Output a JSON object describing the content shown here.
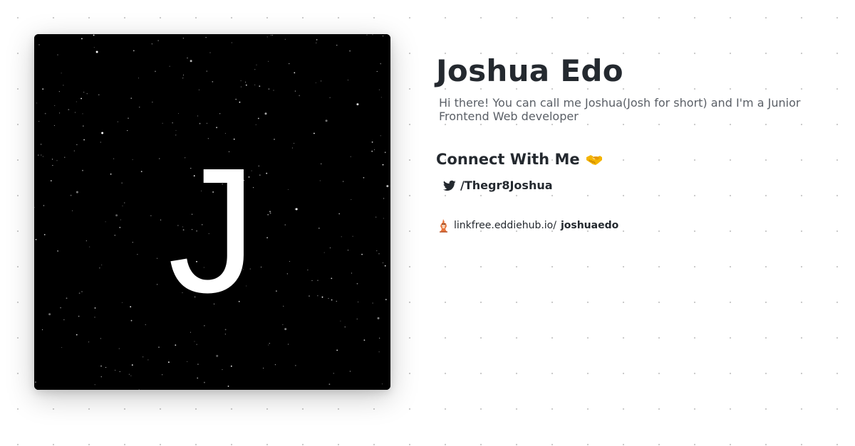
{
  "profile": {
    "avatar_letter": "J",
    "name": "Joshua Edo",
    "bio": "Hi there! You can call me Joshua(Josh for short) and I'm a Junior Frontend Web developer"
  },
  "connect": {
    "heading": "Connect With Me",
    "heading_icon": "handshake-icon",
    "links": [
      {
        "icon": "twitter-icon",
        "label": "/Thegr8Joshua"
      }
    ]
  },
  "footer": {
    "icon": "linkfree-logo-icon",
    "domain": "linkfree.eddiehub.io/",
    "username": "joshuaedo"
  },
  "colors": {
    "avatar_background": "#000000",
    "avatar_letter": "#ffffff",
    "heading_text": "#24292f",
    "bio_text": "#5a5f66",
    "background_dots": "#c9c9c9"
  }
}
